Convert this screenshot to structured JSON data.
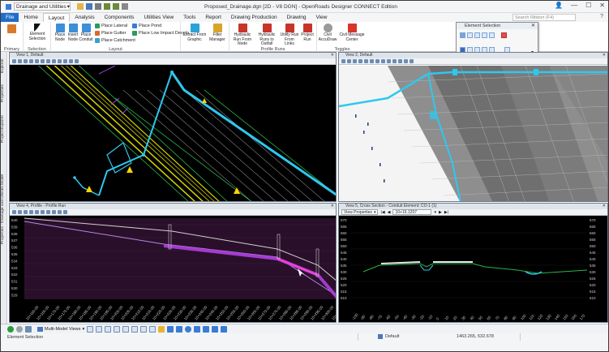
{
  "titlebar": {
    "workspace": "Drainage and Utilities",
    "title": "Proposed_Drainage.dgn [2D - V8 DGN] - OpenRoads Designer CONNECT Edition",
    "min": "—",
    "max": "☐",
    "close": "✕"
  },
  "tabs": [
    "File",
    "Home",
    "Layout",
    "Analysis",
    "Components",
    "Utilities View",
    "Tools",
    "Report",
    "Drawing Production",
    "Drawing",
    "View"
  ],
  "active_tab": "Layout",
  "search_placeholder": "Search Ribbon (F4)",
  "ribbon": {
    "primary_label": "Primary",
    "selection_label": "Selection",
    "element_selection": "Element Selection",
    "layout_label": "Layout",
    "place_node": "Place Node",
    "insert_node": "Insert Node",
    "place_conduit": "Place Conduit",
    "place_lateral": "Place Lateral",
    "place_gutter": "Place Gutter",
    "place_catchment": "Place Catchment",
    "place_pond": "Place Pond",
    "place_low_impact": "Place Low Impact Develo...",
    "extract_from_graphic": "Extract From Graphic",
    "filter_manager": "Filter Manager",
    "hydraulic_run_from_node": "Hydraulic Run From Node",
    "hydraulic_runs_to_outfall": "Hydraulic Runs to Outfall",
    "utility_run_from_links": "Utility Run From Links",
    "project_run": "Project Run",
    "profile_runs_label": "Profile Runs",
    "civil_accudraw": "Civil AccuDraw",
    "civil_message_center": "Civil Message Center",
    "toggles_label": "Toggles"
  },
  "element_selection_dialog": {
    "title": "Element Selection"
  },
  "left_tabs": [
    "Explorer",
    "Properties",
    "Project Explorer",
    "Properties - Drainage and Utilities Model"
  ],
  "views": {
    "v1": {
      "title": "View 1, Default"
    },
    "v2": {
      "title": "View 2, Default"
    },
    "v4": {
      "title": "View 4, Profile - Profile Run"
    },
    "v5": {
      "title": "View 5, Cross Section - Conduit Element: CO-1 (1)",
      "view_properties": "View Properties",
      "station": "10+16.1207"
    }
  },
  "profile_axis": [
    "540",
    "539",
    "538",
    "537",
    "536",
    "535",
    "534",
    "533",
    "532",
    "531",
    "530",
    "529"
  ],
  "profile_stations": [
    "10+160.00",
    "10+165.00",
    "10+170.00",
    "10+175.00",
    "10+180.00",
    "10+185.00",
    "10+190.00",
    "10+195.00",
    "10+200.00",
    "10+205.00",
    "10+210.00",
    "10+215.00",
    "10+220.00",
    "10+225.00",
    "10+230.00",
    "10+235.00",
    "10+240.00",
    "10+245.00",
    "10+250.00",
    "10+255.00",
    "10+260.00",
    "10+265.00",
    "10+270.00",
    "10+275.00",
    "10+280.00",
    "10+285.00",
    "10+290.00",
    "10+295.00",
    "10+300.00",
    "10+305.00"
  ],
  "xs_axis": [
    "570",
    "565",
    "560",
    "555",
    "550",
    "545",
    "540",
    "535",
    "530",
    "525",
    "520",
    "515",
    "510"
  ],
  "xs_stations": [
    "-100",
    "-90",
    "-80",
    "-70",
    "-60",
    "-50",
    "-40",
    "-30",
    "-20",
    "-10",
    "0",
    "10",
    "20",
    "30",
    "40",
    "50",
    "60",
    "70",
    "80",
    "90",
    "100",
    "110",
    "120",
    "130",
    "140",
    "150",
    "160",
    "170"
  ],
  "bottombar": {
    "multi_model_views": "Multi-Model Views"
  },
  "status": {
    "message": "Element Selection",
    "level": "Default",
    "coordinates": "1463.265, 532.678"
  },
  "colors": {
    "accent": "#1e6fc9",
    "profile_bg": "#2a0f2a",
    "road": "#d4d400",
    "pipe": "#2ec8ef"
  }
}
